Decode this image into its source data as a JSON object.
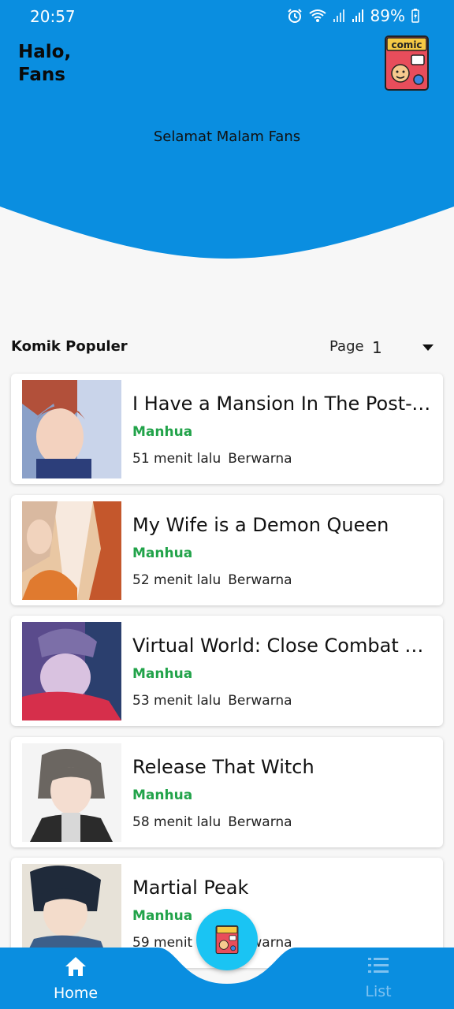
{
  "status_bar": {
    "time": "20:57",
    "battery": "89%"
  },
  "header": {
    "greeting": "Halo,\nFans",
    "welcome": "Selamat Malam Fans",
    "logo_text": "comic",
    "color": "#0a8ee0"
  },
  "section": {
    "title": "Komik Populer",
    "page_label": "Page",
    "page_value": "1"
  },
  "comics": [
    {
      "title": "I Have a Mansion In The Post-Ap...",
      "type": "Manhua",
      "time": "51 menit lalu",
      "color": "Berwarna"
    },
    {
      "title": "My Wife is a Demon Queen",
      "type": "Manhua",
      "time": "52 menit lalu",
      "color": "Berwarna"
    },
    {
      "title": "Virtual World: Close Combat Ma...",
      "type": "Manhua",
      "time": "53 menit lalu",
      "color": "Berwarna"
    },
    {
      "title": "Release That Witch",
      "type": "Manhua",
      "time": "58 menit lalu",
      "color": "Berwarna"
    },
    {
      "title": "Martial Peak",
      "type": "Manhua",
      "time": "59 menit lalu",
      "color": "Berwarna"
    }
  ],
  "nav": {
    "home_label": "Home",
    "list_label": "List",
    "home_icon": "home-icon",
    "list_icon": "list-icon"
  }
}
